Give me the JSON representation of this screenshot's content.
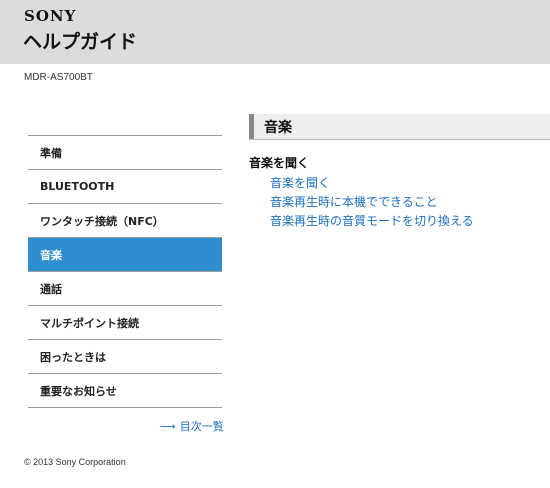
{
  "header": {
    "brand": "SONY",
    "title": "ヘルプガイド"
  },
  "model": "MDR-AS700BT",
  "sidebar": {
    "items": [
      {
        "label": "準備"
      },
      {
        "label": "BLUETOOTH"
      },
      {
        "label": "ワンタッチ接続（NFC）"
      },
      {
        "label": "音楽",
        "active": true
      },
      {
        "label": "通話"
      },
      {
        "label": "マルチポイント接続"
      },
      {
        "label": "困ったときは"
      },
      {
        "label": "重要なお知らせ"
      }
    ],
    "toc_label": "目次一覧",
    "toc_arrow": "⟶"
  },
  "main": {
    "section_title": "音楽",
    "sub_heading": "音楽を聞く",
    "links": [
      {
        "label": "音楽を聞く"
      },
      {
        "label": "音楽再生時に本機でできること"
      },
      {
        "label": "音楽再生時の音質モードを切り換える"
      }
    ]
  },
  "footer": {
    "copyright": "© 2013 Sony Corporation"
  },
  "colors": {
    "header_bg": "#dcdcdc",
    "active_bg": "#2f8fce",
    "link": "#1a6fbf"
  }
}
